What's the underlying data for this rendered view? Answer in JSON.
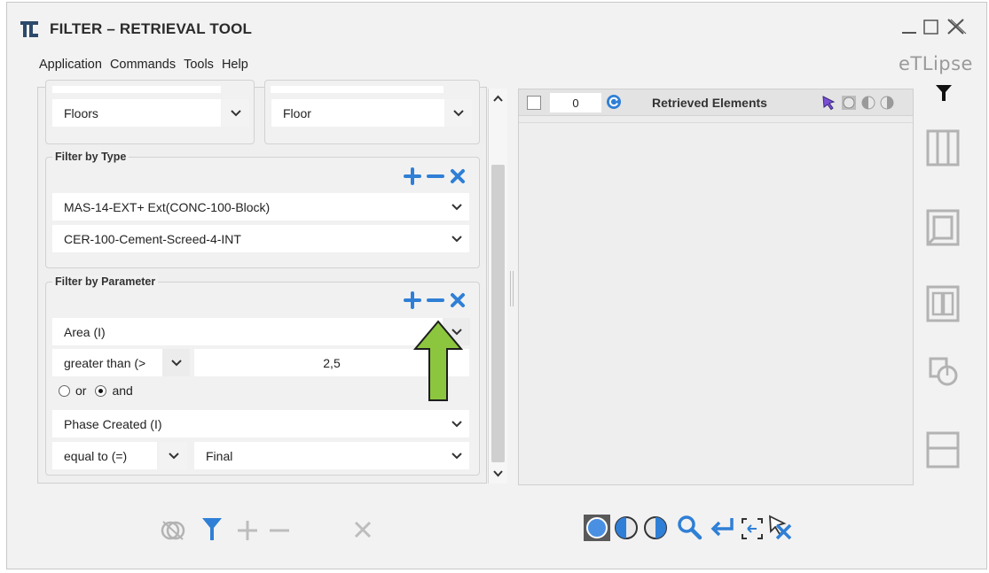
{
  "window": {
    "title": "FILTER – RETRIEVAL TOOL",
    "logo": "eTLipse"
  },
  "menu": [
    "Application",
    "Commands",
    "Tools",
    "Help"
  ],
  "top_selects": {
    "left_value": "Floors",
    "right_value": "Floor"
  },
  "filter_by_type": {
    "label": "Filter by Type",
    "items": [
      "MAS-14-EXT+ Ext(CONC-100-Block)",
      "CER-100-Cement-Screed-4-INT"
    ]
  },
  "filter_by_parameter": {
    "label": "Filter by Parameter",
    "param1": "Area (I)",
    "operator1": "greater than (>)",
    "operator1_display": "greater than (>",
    "value1": "2,5",
    "logic_or": "or",
    "logic_and": "and",
    "logic_selected": "and",
    "param2": "Phase Created (I)",
    "operator2": "equal to (=)",
    "value2": "Final"
  },
  "retrieved": {
    "count": "0",
    "title": "Retrieved Elements"
  },
  "colors": {
    "accent_blue": "#2f7fd6",
    "arrow_green": "#8cc63f",
    "icon_gray": "#b3b3b3"
  }
}
